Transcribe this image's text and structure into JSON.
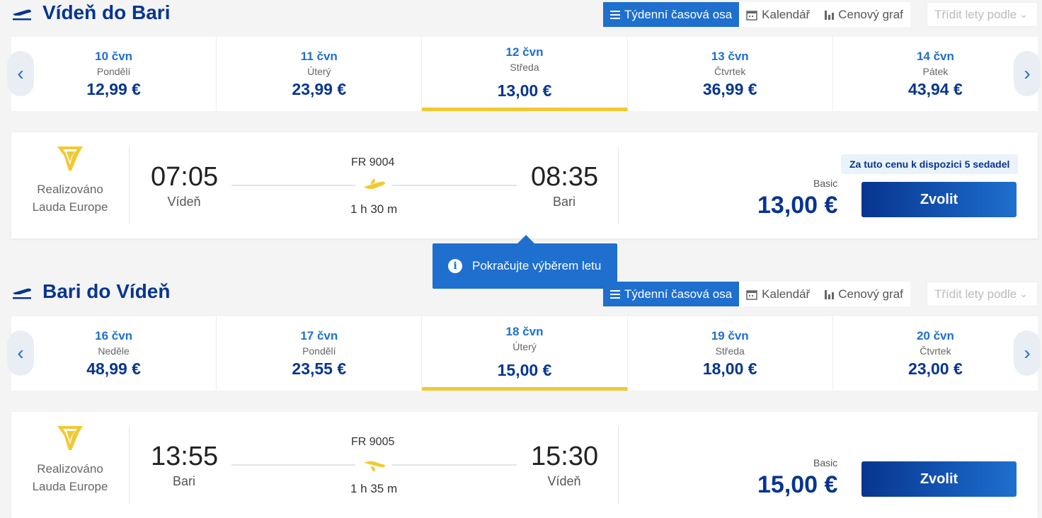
{
  "view_tabs": {
    "weekly": "Týdenní časová osa",
    "calendar": "Kalendář",
    "price_chart": "Cenový graf",
    "sort": "Třídit lety podle"
  },
  "outbound": {
    "title": "Vídeň do Bari",
    "dates": [
      {
        "date": "10 čvn",
        "weekday": "Pondělí",
        "price": "12,99 €"
      },
      {
        "date": "11 čvn",
        "weekday": "Úterý",
        "price": "23,99 €"
      },
      {
        "date": "12 čvn",
        "weekday": "Středa",
        "price": "13,00 €"
      },
      {
        "date": "13 čvn",
        "weekday": "Čtvrtek",
        "price": "36,99 €"
      },
      {
        "date": "14 čvn",
        "weekday": "Pátek",
        "price": "43,94 €"
      }
    ],
    "flight": {
      "operator": "Realizováno Lauda Europe",
      "dep_time": "07:05",
      "dep_city": "Vídeň",
      "arr_time": "08:35",
      "arr_city": "Bari",
      "flight_number": "FR 9004",
      "duration": "1 h 30 m",
      "seats_note": "Za tuto cenu k dispozici 5 sedadel",
      "fare": "Basic",
      "price": "13,00 €",
      "select": "Zvolit"
    }
  },
  "tooltip": "Pokračujte výběrem letu",
  "return": {
    "title": "Bari do Vídeň",
    "dates": [
      {
        "date": "16 čvn",
        "weekday": "Neděle",
        "price": "48,99 €"
      },
      {
        "date": "17 čvn",
        "weekday": "Pondělí",
        "price": "23,55 €"
      },
      {
        "date": "18 čvn",
        "weekday": "Úterý",
        "price": "15,00 €"
      },
      {
        "date": "19 čvn",
        "weekday": "Středa",
        "price": "18,00 €"
      },
      {
        "date": "20 čvn",
        "weekday": "Čtvrtek",
        "price": "23,00 €"
      }
    ],
    "flight": {
      "operator": "Realizováno Lauda Europe",
      "dep_time": "13:55",
      "dep_city": "Bari",
      "arr_time": "15:30",
      "arr_city": "Vídeň",
      "flight_number": "FR 9005",
      "duration": "1 h 35 m",
      "fare": "Basic",
      "price": "15,00 €",
      "select": "Zvolit"
    }
  },
  "colors": {
    "brand_blue": "#073590",
    "accent_blue": "#1e6fce",
    "yellow": "#f1c933"
  }
}
